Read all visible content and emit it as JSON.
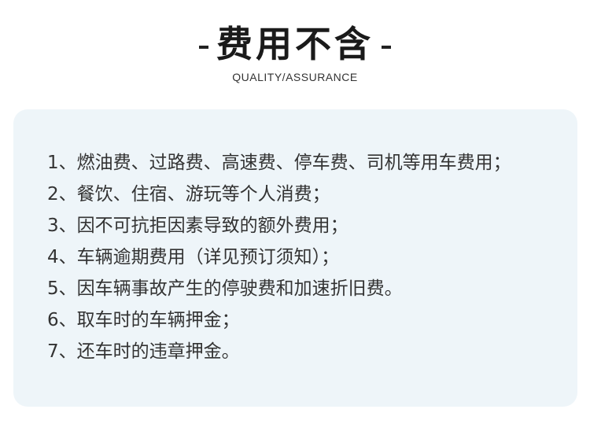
{
  "header": {
    "title": "费用不含",
    "subtitle": "QUALITY/ASSURANCE"
  },
  "items": [
    "1、燃油费、过路费、高速费、停车费、司机等用车费用；",
    "2、餐饮、住宿、游玩等个人消费；",
    "3、因不可抗拒因素导致的额外费用；",
    "4、车辆逾期费用（详见预订须知）；",
    "5、因车辆事故产生的停驶费和加速折旧费。",
    "6、取车时的车辆押金；",
    "7、还车时的违章押金。"
  ],
  "colors": {
    "panel_background": "#eef5f9",
    "text": "#333333",
    "title": "#1a1a1a"
  }
}
